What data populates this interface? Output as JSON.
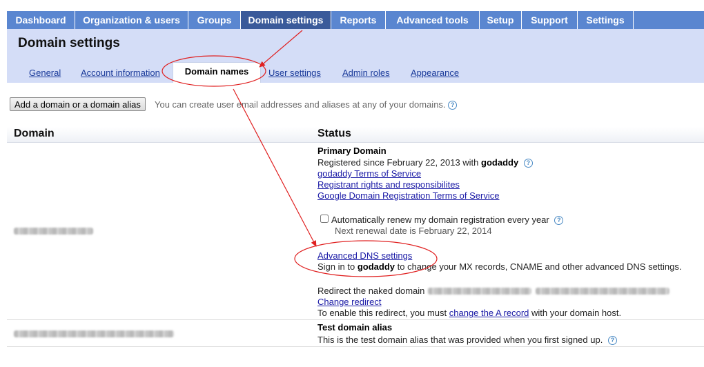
{
  "nav": {
    "tabs": [
      {
        "label": "Dashboard"
      },
      {
        "label": "Organization & users"
      },
      {
        "label": "Groups"
      },
      {
        "label": "Domain settings"
      },
      {
        "label": "Reports"
      },
      {
        "label": "Advanced tools"
      },
      {
        "label": "Setup"
      },
      {
        "label": "Support"
      },
      {
        "label": "Settings"
      }
    ],
    "active": "Domain settings"
  },
  "header": {
    "title": "Domain settings",
    "subtabs": [
      {
        "label": "General"
      },
      {
        "label": "Account information"
      },
      {
        "label": "Domain names"
      },
      {
        "label": "User settings"
      },
      {
        "label": "Admin roles"
      },
      {
        "label": "Appearance"
      }
    ],
    "active_subtab": "Domain names"
  },
  "add_domain": {
    "button_label": "Add a domain or a domain alias",
    "hint": "You can create user email addresses and aliases at any of your domains."
  },
  "table": {
    "headers": {
      "domain": "Domain",
      "status": "Status"
    },
    "primary": {
      "title": "Primary Domain",
      "registered_prefix": "Registered since February 22, 2013 with ",
      "registrar": "godaddy",
      "links": [
        "godaddy Terms of Service",
        "Registrant rights and responsibilites",
        "Google Domain Registration Terms of Service"
      ],
      "renew_label": "Automatically renew my domain registration every year",
      "renew_checked": false,
      "next_renewal": "Next renewal date is February 22, 2014",
      "dns_link": "Advanced DNS settings",
      "dns_prefix": "Sign in to ",
      "dns_registrar": "godaddy",
      "dns_suffix": " to change your MX records, CNAME and other advanced DNS settings.",
      "redirect_label": "Redirect the naked domain",
      "change_redirect": "Change redirect",
      "enable_prefix": "To enable this redirect, you must ",
      "enable_link": "change the A record",
      "enable_suffix": " with your domain host."
    },
    "alias": {
      "title": "Test domain alias",
      "description": "This is the test domain alias that was provided when you first signed up."
    }
  },
  "icons": {
    "help": "help-icon",
    "annotation": "red-arrow-and-ellipse"
  },
  "colors": {
    "nav_tab": "#5a86d0",
    "nav_active": "#3a5a9a",
    "header_bg": "#d4ddf7",
    "annotation": "#e02020",
    "link": "#1a1aa6"
  }
}
